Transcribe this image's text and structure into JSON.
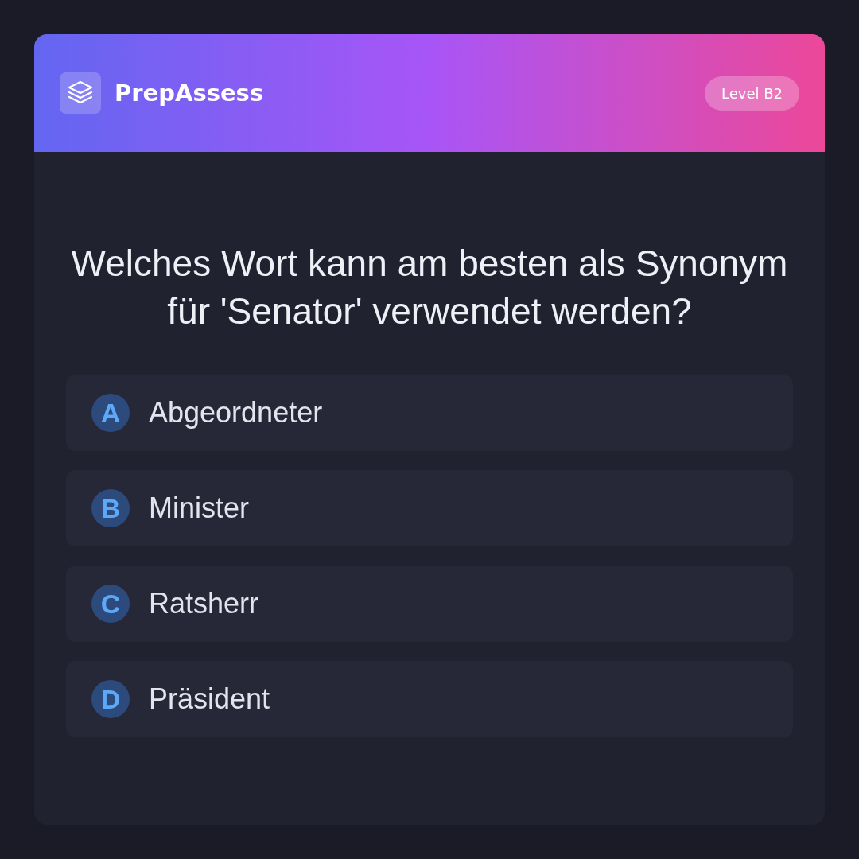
{
  "header": {
    "brand": "PrepAssess",
    "level_badge": "Level B2"
  },
  "question": "Welches Wort kann am besten als Synonym für 'Senator' verwendet werden?",
  "options": [
    {
      "letter": "A",
      "text": "Abgeordneter"
    },
    {
      "letter": "B",
      "text": "Minister"
    },
    {
      "letter": "C",
      "text": "Ratsherr"
    },
    {
      "letter": "D",
      "text": "Präsident"
    }
  ]
}
